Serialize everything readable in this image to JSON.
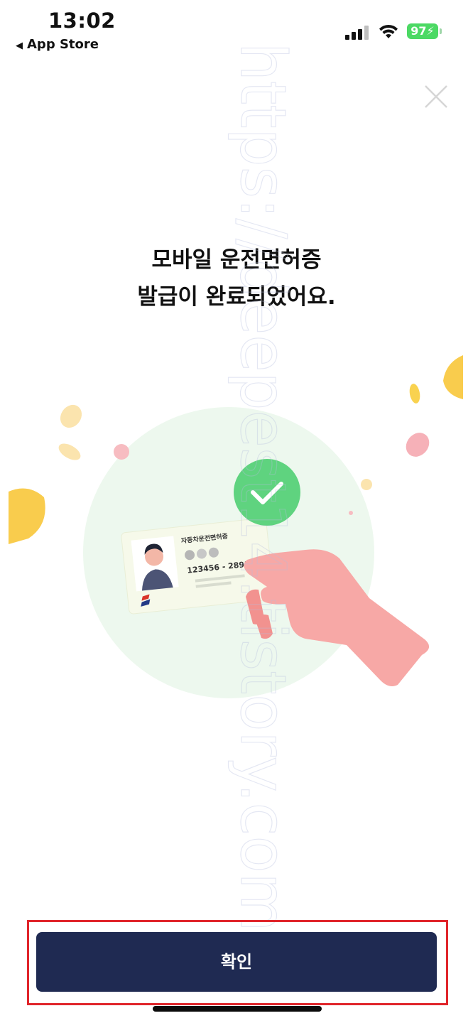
{
  "status_bar": {
    "time": "13:02",
    "back_label": "App Store",
    "battery_level": "97"
  },
  "headline": {
    "line1": "모바일 운전면허증",
    "line2": "발급이 완료되었어요."
  },
  "card": {
    "title": "자동차운전면허증",
    "number": "123456 - 2891012"
  },
  "watermark_text": "https://deepest14.tistory.com/",
  "confirm_label": "확인",
  "colors": {
    "button": "#1f2a52",
    "highlight_frame": "#e0252b",
    "check": "#5fd37f",
    "battery": "#4cd964",
    "hand": "#f7a8a6",
    "accent_yellow": "#f9cc4d",
    "accent_pink": "#f6b1b8",
    "circle_bg": "#eaf7ec"
  },
  "icons": {
    "close": "close-icon",
    "check": "check-icon",
    "back": "back-triangle-icon",
    "signal": "cellular-signal-icon",
    "wifi": "wifi-icon",
    "battery": "battery-icon"
  }
}
